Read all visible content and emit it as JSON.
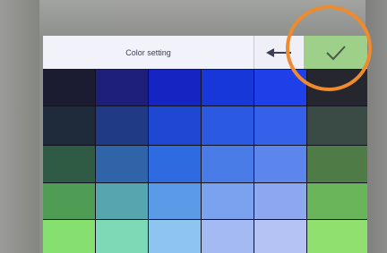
{
  "header": {
    "title": "Color setting",
    "back_icon": "arrow-left-icon",
    "confirm_icon": "checkmark-icon"
  },
  "annotation": {
    "color": "#ef8a2d"
  },
  "swatches": [
    [
      "#1b1c32",
      "#1d1f7a",
      "#1624c2",
      "#1737d8",
      "#1f3fe8",
      "#25262e"
    ],
    [
      "#1f2a3a",
      "#213a86",
      "#1e48d2",
      "#2c59e2",
      "#3560ea",
      "#3a4a45"
    ],
    [
      "#2f5a44",
      "#2f64a8",
      "#2e6ae0",
      "#4a7ce8",
      "#5c86ec",
      "#4f7c46"
    ],
    [
      "#4f9c54",
      "#56a6b0",
      "#5b9ae6",
      "#7aa2ee",
      "#8ea8f0",
      "#6ab45a"
    ],
    [
      "#86e070",
      "#7ed9b6",
      "#8ec4f0",
      "#a3baf3",
      "#b5c2f4",
      "#90e070"
    ]
  ]
}
